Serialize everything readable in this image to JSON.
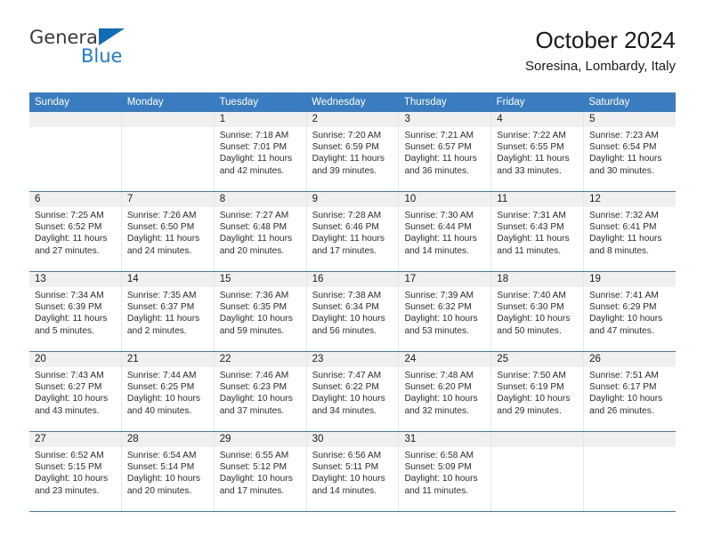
{
  "brand": {
    "name_top": "General",
    "name_bottom": "Blue",
    "accent_color": "#0f6cb5",
    "secondary_color": "#1a7fd4"
  },
  "header": {
    "title": "October 2024",
    "subtitle": "Soresina, Lombardy, Italy"
  },
  "calendar": {
    "header_color": "#3a7cc0",
    "weekdays": [
      "Sunday",
      "Monday",
      "Tuesday",
      "Wednesday",
      "Thursday",
      "Friday",
      "Saturday"
    ],
    "weeks": [
      [
        {
          "day": "",
          "sunrise": "",
          "sunset": "",
          "daylight": "",
          "empty": true
        },
        {
          "day": "",
          "sunrise": "",
          "sunset": "",
          "daylight": "",
          "empty": true
        },
        {
          "day": "1",
          "sunrise": "Sunrise: 7:18 AM",
          "sunset": "Sunset: 7:01 PM",
          "daylight": "Daylight: 11 hours and 42 minutes."
        },
        {
          "day": "2",
          "sunrise": "Sunrise: 7:20 AM",
          "sunset": "Sunset: 6:59 PM",
          "daylight": "Daylight: 11 hours and 39 minutes."
        },
        {
          "day": "3",
          "sunrise": "Sunrise: 7:21 AM",
          "sunset": "Sunset: 6:57 PM",
          "daylight": "Daylight: 11 hours and 36 minutes."
        },
        {
          "day": "4",
          "sunrise": "Sunrise: 7:22 AM",
          "sunset": "Sunset: 6:55 PM",
          "daylight": "Daylight: 11 hours and 33 minutes."
        },
        {
          "day": "5",
          "sunrise": "Sunrise: 7:23 AM",
          "sunset": "Sunset: 6:54 PM",
          "daylight": "Daylight: 11 hours and 30 minutes."
        }
      ],
      [
        {
          "day": "6",
          "sunrise": "Sunrise: 7:25 AM",
          "sunset": "Sunset: 6:52 PM",
          "daylight": "Daylight: 11 hours and 27 minutes."
        },
        {
          "day": "7",
          "sunrise": "Sunrise: 7:26 AM",
          "sunset": "Sunset: 6:50 PM",
          "daylight": "Daylight: 11 hours and 24 minutes."
        },
        {
          "day": "8",
          "sunrise": "Sunrise: 7:27 AM",
          "sunset": "Sunset: 6:48 PM",
          "daylight": "Daylight: 11 hours and 20 minutes."
        },
        {
          "day": "9",
          "sunrise": "Sunrise: 7:28 AM",
          "sunset": "Sunset: 6:46 PM",
          "daylight": "Daylight: 11 hours and 17 minutes."
        },
        {
          "day": "10",
          "sunrise": "Sunrise: 7:30 AM",
          "sunset": "Sunset: 6:44 PM",
          "daylight": "Daylight: 11 hours and 14 minutes."
        },
        {
          "day": "11",
          "sunrise": "Sunrise: 7:31 AM",
          "sunset": "Sunset: 6:43 PM",
          "daylight": "Daylight: 11 hours and 11 minutes."
        },
        {
          "day": "12",
          "sunrise": "Sunrise: 7:32 AM",
          "sunset": "Sunset: 6:41 PM",
          "daylight": "Daylight: 11 hours and 8 minutes."
        }
      ],
      [
        {
          "day": "13",
          "sunrise": "Sunrise: 7:34 AM",
          "sunset": "Sunset: 6:39 PM",
          "daylight": "Daylight: 11 hours and 5 minutes."
        },
        {
          "day": "14",
          "sunrise": "Sunrise: 7:35 AM",
          "sunset": "Sunset: 6:37 PM",
          "daylight": "Daylight: 11 hours and 2 minutes."
        },
        {
          "day": "15",
          "sunrise": "Sunrise: 7:36 AM",
          "sunset": "Sunset: 6:35 PM",
          "daylight": "Daylight: 10 hours and 59 minutes."
        },
        {
          "day": "16",
          "sunrise": "Sunrise: 7:38 AM",
          "sunset": "Sunset: 6:34 PM",
          "daylight": "Daylight: 10 hours and 56 minutes."
        },
        {
          "day": "17",
          "sunrise": "Sunrise: 7:39 AM",
          "sunset": "Sunset: 6:32 PM",
          "daylight": "Daylight: 10 hours and 53 minutes."
        },
        {
          "day": "18",
          "sunrise": "Sunrise: 7:40 AM",
          "sunset": "Sunset: 6:30 PM",
          "daylight": "Daylight: 10 hours and 50 minutes."
        },
        {
          "day": "19",
          "sunrise": "Sunrise: 7:41 AM",
          "sunset": "Sunset: 6:29 PM",
          "daylight": "Daylight: 10 hours and 47 minutes."
        }
      ],
      [
        {
          "day": "20",
          "sunrise": "Sunrise: 7:43 AM",
          "sunset": "Sunset: 6:27 PM",
          "daylight": "Daylight: 10 hours and 43 minutes."
        },
        {
          "day": "21",
          "sunrise": "Sunrise: 7:44 AM",
          "sunset": "Sunset: 6:25 PM",
          "daylight": "Daylight: 10 hours and 40 minutes."
        },
        {
          "day": "22",
          "sunrise": "Sunrise: 7:46 AM",
          "sunset": "Sunset: 6:23 PM",
          "daylight": "Daylight: 10 hours and 37 minutes."
        },
        {
          "day": "23",
          "sunrise": "Sunrise: 7:47 AM",
          "sunset": "Sunset: 6:22 PM",
          "daylight": "Daylight: 10 hours and 34 minutes."
        },
        {
          "day": "24",
          "sunrise": "Sunrise: 7:48 AM",
          "sunset": "Sunset: 6:20 PM",
          "daylight": "Daylight: 10 hours and 32 minutes."
        },
        {
          "day": "25",
          "sunrise": "Sunrise: 7:50 AM",
          "sunset": "Sunset: 6:19 PM",
          "daylight": "Daylight: 10 hours and 29 minutes."
        },
        {
          "day": "26",
          "sunrise": "Sunrise: 7:51 AM",
          "sunset": "Sunset: 6:17 PM",
          "daylight": "Daylight: 10 hours and 26 minutes."
        }
      ],
      [
        {
          "day": "27",
          "sunrise": "Sunrise: 6:52 AM",
          "sunset": "Sunset: 5:15 PM",
          "daylight": "Daylight: 10 hours and 23 minutes."
        },
        {
          "day": "28",
          "sunrise": "Sunrise: 6:54 AM",
          "sunset": "Sunset: 5:14 PM",
          "daylight": "Daylight: 10 hours and 20 minutes."
        },
        {
          "day": "29",
          "sunrise": "Sunrise: 6:55 AM",
          "sunset": "Sunset: 5:12 PM",
          "daylight": "Daylight: 10 hours and 17 minutes."
        },
        {
          "day": "30",
          "sunrise": "Sunrise: 6:56 AM",
          "sunset": "Sunset: 5:11 PM",
          "daylight": "Daylight: 10 hours and 14 minutes."
        },
        {
          "day": "31",
          "sunrise": "Sunrise: 6:58 AM",
          "sunset": "Sunset: 5:09 PM",
          "daylight": "Daylight: 10 hours and 11 minutes."
        },
        {
          "day": "",
          "sunrise": "",
          "sunset": "",
          "daylight": "",
          "empty": true
        },
        {
          "day": "",
          "sunrise": "",
          "sunset": "",
          "daylight": "",
          "empty": true
        }
      ]
    ]
  }
}
